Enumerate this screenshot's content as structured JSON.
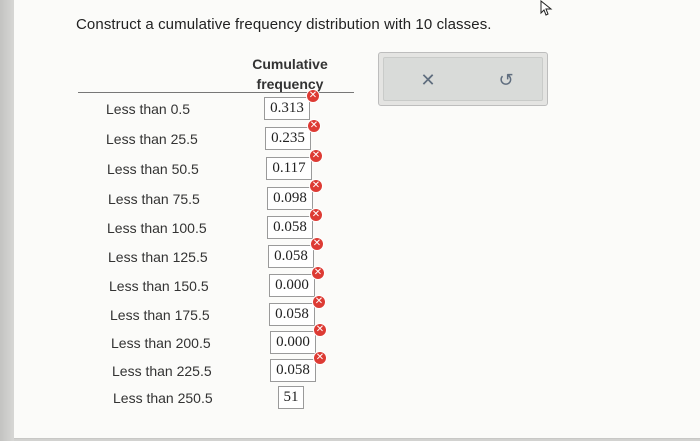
{
  "question": "Construct a cumulative frequency distribution with 10 classes.",
  "table": {
    "header_line1": "Cumulative",
    "header_line2": "frequency",
    "rows": [
      {
        "label": "Less than 0.5",
        "value": "0.313"
      },
      {
        "label": "Less than 25.5",
        "value": "0.235"
      },
      {
        "label": "Less than 50.5",
        "value": "0.117"
      },
      {
        "label": "Less than 75.5",
        "value": "0.098"
      },
      {
        "label": "Less than 100.5",
        "value": "0.058"
      },
      {
        "label": "Less than 125.5",
        "value": "0.058"
      },
      {
        "label": "Less than 150.5",
        "value": "0.000"
      },
      {
        "label": "Less than 175.5",
        "value": "0.058"
      },
      {
        "label": "Less than 200.5",
        "value": "0.000"
      },
      {
        "label": "Less than 225.5",
        "value": "0.058"
      },
      {
        "label": "Less than 250.5",
        "value": "51"
      }
    ],
    "error_icon": "x-error-badge"
  },
  "actions": {
    "clear_symbol": "✕",
    "reset_symbol": "↺"
  },
  "colors": {
    "error": "#dd3b34",
    "icon": "#5f6d7e"
  }
}
